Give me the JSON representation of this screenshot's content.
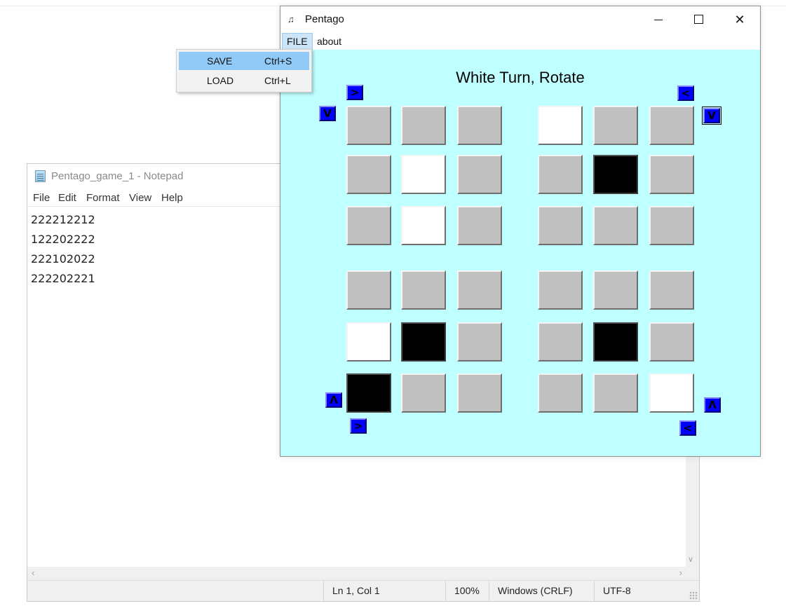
{
  "notepad": {
    "title": "Pentago_game_1 - Notepad",
    "menu": [
      "File",
      "Edit",
      "Format",
      "View",
      "Help"
    ],
    "lines": [
      "222212212",
      "122202222",
      "222102022",
      "222202221"
    ],
    "status": {
      "position": "Ln 1, Col 1",
      "zoom": "100%",
      "line_ending": "Windows (CRLF)",
      "encoding": "UTF-8"
    }
  },
  "pentago": {
    "title": "Pentago",
    "menu": {
      "file": "FILE",
      "about": "about"
    },
    "status_text": "White Turn, Rotate",
    "board": [
      [
        "empty",
        "empty",
        "empty",
        "white",
        "empty",
        "empty"
      ],
      [
        "empty",
        "white",
        "empty",
        "empty",
        "black",
        "empty"
      ],
      [
        "empty",
        "white",
        "empty",
        "empty",
        "empty",
        "empty"
      ],
      [
        "empty",
        "empty",
        "empty",
        "empty",
        "empty",
        "empty"
      ],
      [
        "white",
        "black",
        "empty",
        "empty",
        "black",
        "empty"
      ],
      [
        "black",
        "empty",
        "empty",
        "empty",
        "empty",
        "white"
      ]
    ],
    "rotate_buttons": {
      "top_left_right": ">",
      "top_left_down": "V",
      "top_right_left": "<",
      "top_right_down": "V",
      "bottom_left_up": "Λ",
      "bottom_left_right": ">",
      "bottom_right_up": "Λ",
      "bottom_right_left": "<"
    },
    "colors": {
      "background": "#c0ffff",
      "rotate_button": "#0000ff",
      "cell": "#c0c0c0"
    }
  },
  "file_menu": {
    "items": [
      {
        "label": "SAVE",
        "shortcut": "Ctrl+S"
      },
      {
        "label": "LOAD",
        "shortcut": "Ctrl+L"
      }
    ]
  }
}
